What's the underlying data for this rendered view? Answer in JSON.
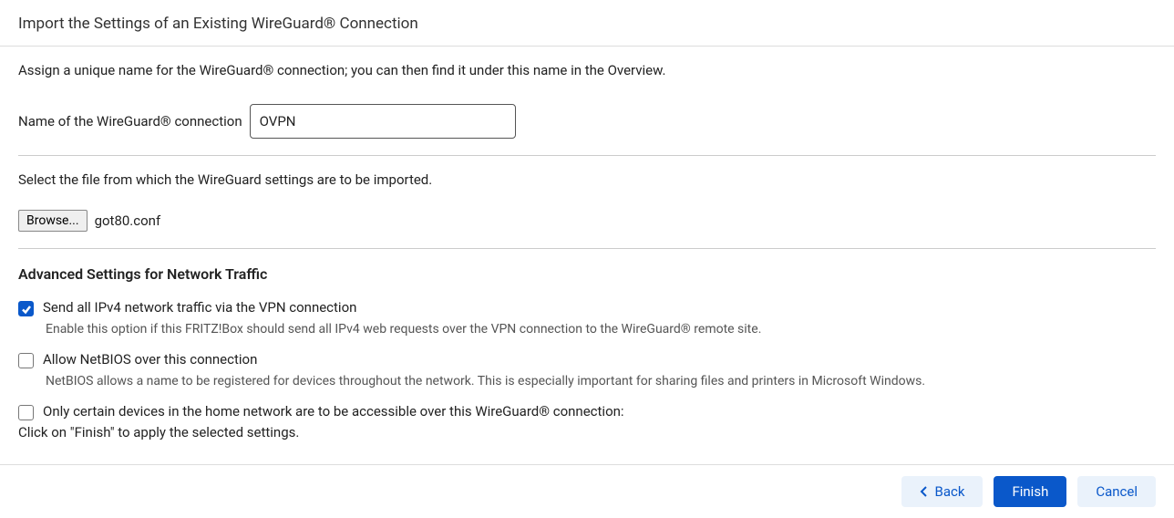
{
  "page_title": "Import the Settings of an Existing WireGuard® Connection",
  "instruction_name": "Assign a unique name for the WireGuard® connection; you can then find it under this name in the Overview.",
  "name_label": "Name of the WireGuard® connection",
  "name_value": "OVPN",
  "instruction_file": "Select the file from which the WireGuard settings are to be imported.",
  "browse_label": "Browse...",
  "selected_file": "got80.conf",
  "advanced_heading": "Advanced Settings for Network Traffic",
  "checkboxes": {
    "ipv4": {
      "label": "Send all IPv4 network traffic via the VPN connection",
      "help": "Enable this option if this FRITZ!Box should send all IPv4 web requests over the VPN connection to the WireGuard® remote site.",
      "checked": true
    },
    "netbios": {
      "label": "Allow NetBIOS over this connection",
      "help": "NetBIOS allows a name to be registered for devices throughout the network. This is especially important for sharing files and printers in Microsoft Windows.",
      "checked": false
    },
    "devices": {
      "label": "Only certain devices in the home network are to be accessible over this WireGuard® connection:",
      "checked": false
    }
  },
  "finish_note": "Click on \"Finish\" to apply the selected settings.",
  "buttons": {
    "back": "Back",
    "finish": "Finish",
    "cancel": "Cancel"
  }
}
